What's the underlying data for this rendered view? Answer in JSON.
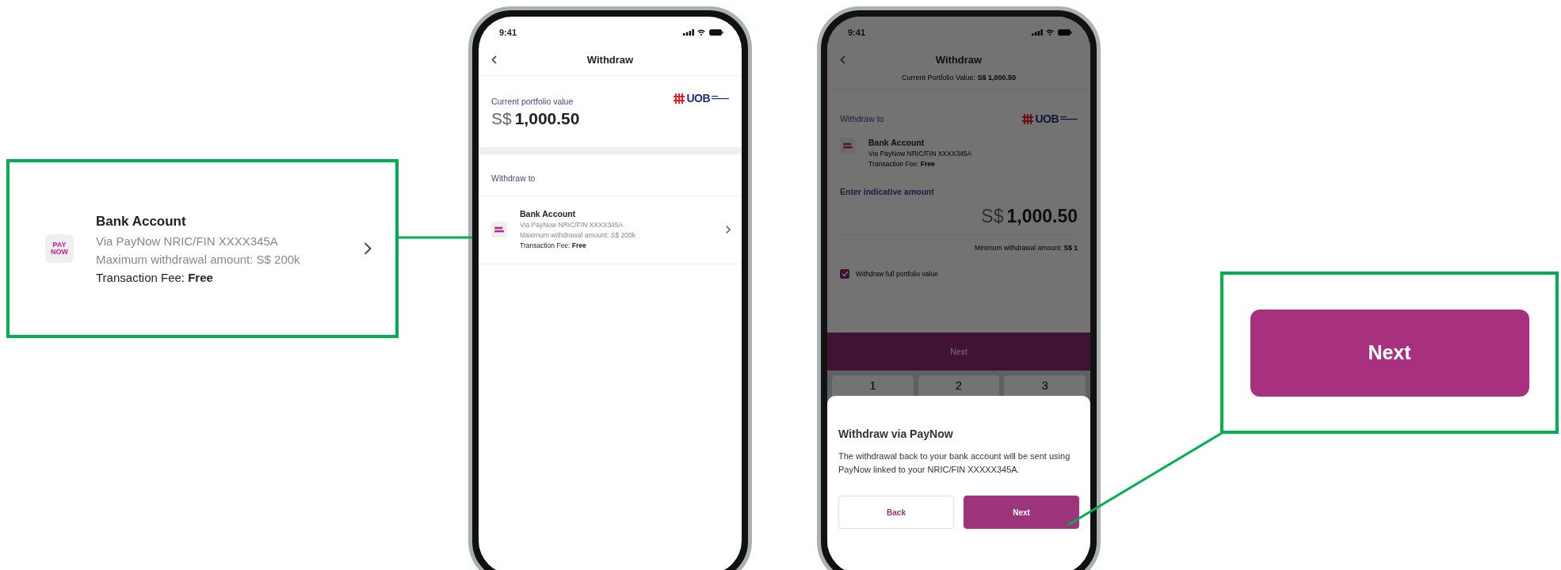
{
  "account_callout": {
    "logo_text": [
      "PAY",
      "NOW"
    ],
    "title": "Bank Account",
    "lines": [
      "Via PayNow NRIC/FIN XXXX345A",
      "Maximum withdrawal amount: S$ 200k"
    ],
    "fee": "Transaction Fee: **Free**"
  },
  "phone_1": {
    "status_time": "9:41",
    "title": "Withdraw",
    "portfolio_label": "Current portfolio value",
    "currency": "S$",
    "amount": "1,000.50",
    "logo_text": "UOB",
    "section_label": "Withdraw to",
    "account": {
      "title": "Bank Account",
      "lines": [
        "Via PayNow NRIC/FIN XXXX345A",
        "Maximum withdrawal amount: S$ 200k"
      ],
      "fee": "Transaction Fee: **Free**"
    }
  },
  "phone_2": {
    "status_time": "9:41",
    "title": "Withdraw",
    "subtitle": "Current Portfolio Value: **S$ 1,000.50**",
    "section_label": "Withdraw to",
    "logo_text": "UOB",
    "account": {
      "title": "Bank Account",
      "lines": [
        "Via PayNow NRIC/FIN XXXX345A"
      ],
      "fee": "Transaction Fee: **Free**"
    },
    "amount_label": "Enter indicative amount",
    "currency": "S$",
    "amount": "1,000.50",
    "minimum": "Minimum withdrawal amount: **S$ 1**",
    "full_value_checkbox": {
      "label": "Withdraw full portfolio value",
      "checked": true
    },
    "next_button": "Next",
    "keypad": [
      "1",
      "2",
      "3"
    ],
    "sheet": {
      "title": "Withdraw via PayNow",
      "body": "The withdrawal back to your bank account will be sent using PayNow linked to your NRIC/FIN XXXXX345A.",
      "buttons": [
        {
          "label": "Back",
          "kind": "secondary"
        },
        {
          "label": "Next",
          "kind": "primary"
        }
      ]
    }
  },
  "button_callout": {
    "label": "Next"
  }
}
